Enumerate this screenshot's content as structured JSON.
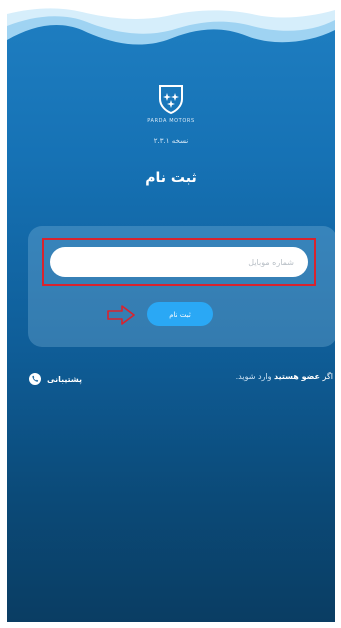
{
  "app": {
    "brand": "PARDA MOTORS",
    "version": "نسخه ۲.۳.۱"
  },
  "page": {
    "title": "ثبت نام"
  },
  "form": {
    "mobile_placeholder": "شماره موبایل",
    "mobile_value": "",
    "submit_label": "ثبت نام"
  },
  "footer": {
    "member_prefix": "اگر",
    "member_bold": "عضو هستید",
    "member_link": "وارد شوید.",
    "support_label": "پشتیبانی"
  },
  "annotations": {
    "highlight_color": "#d9232e"
  },
  "icons": [
    "logo-shield-icon",
    "arrow-right-icon",
    "phone-icon"
  ],
  "colors": {
    "button": "#2aa8f5",
    "background_top": "#1f7fc2",
    "background_bottom": "#0a3d63"
  }
}
